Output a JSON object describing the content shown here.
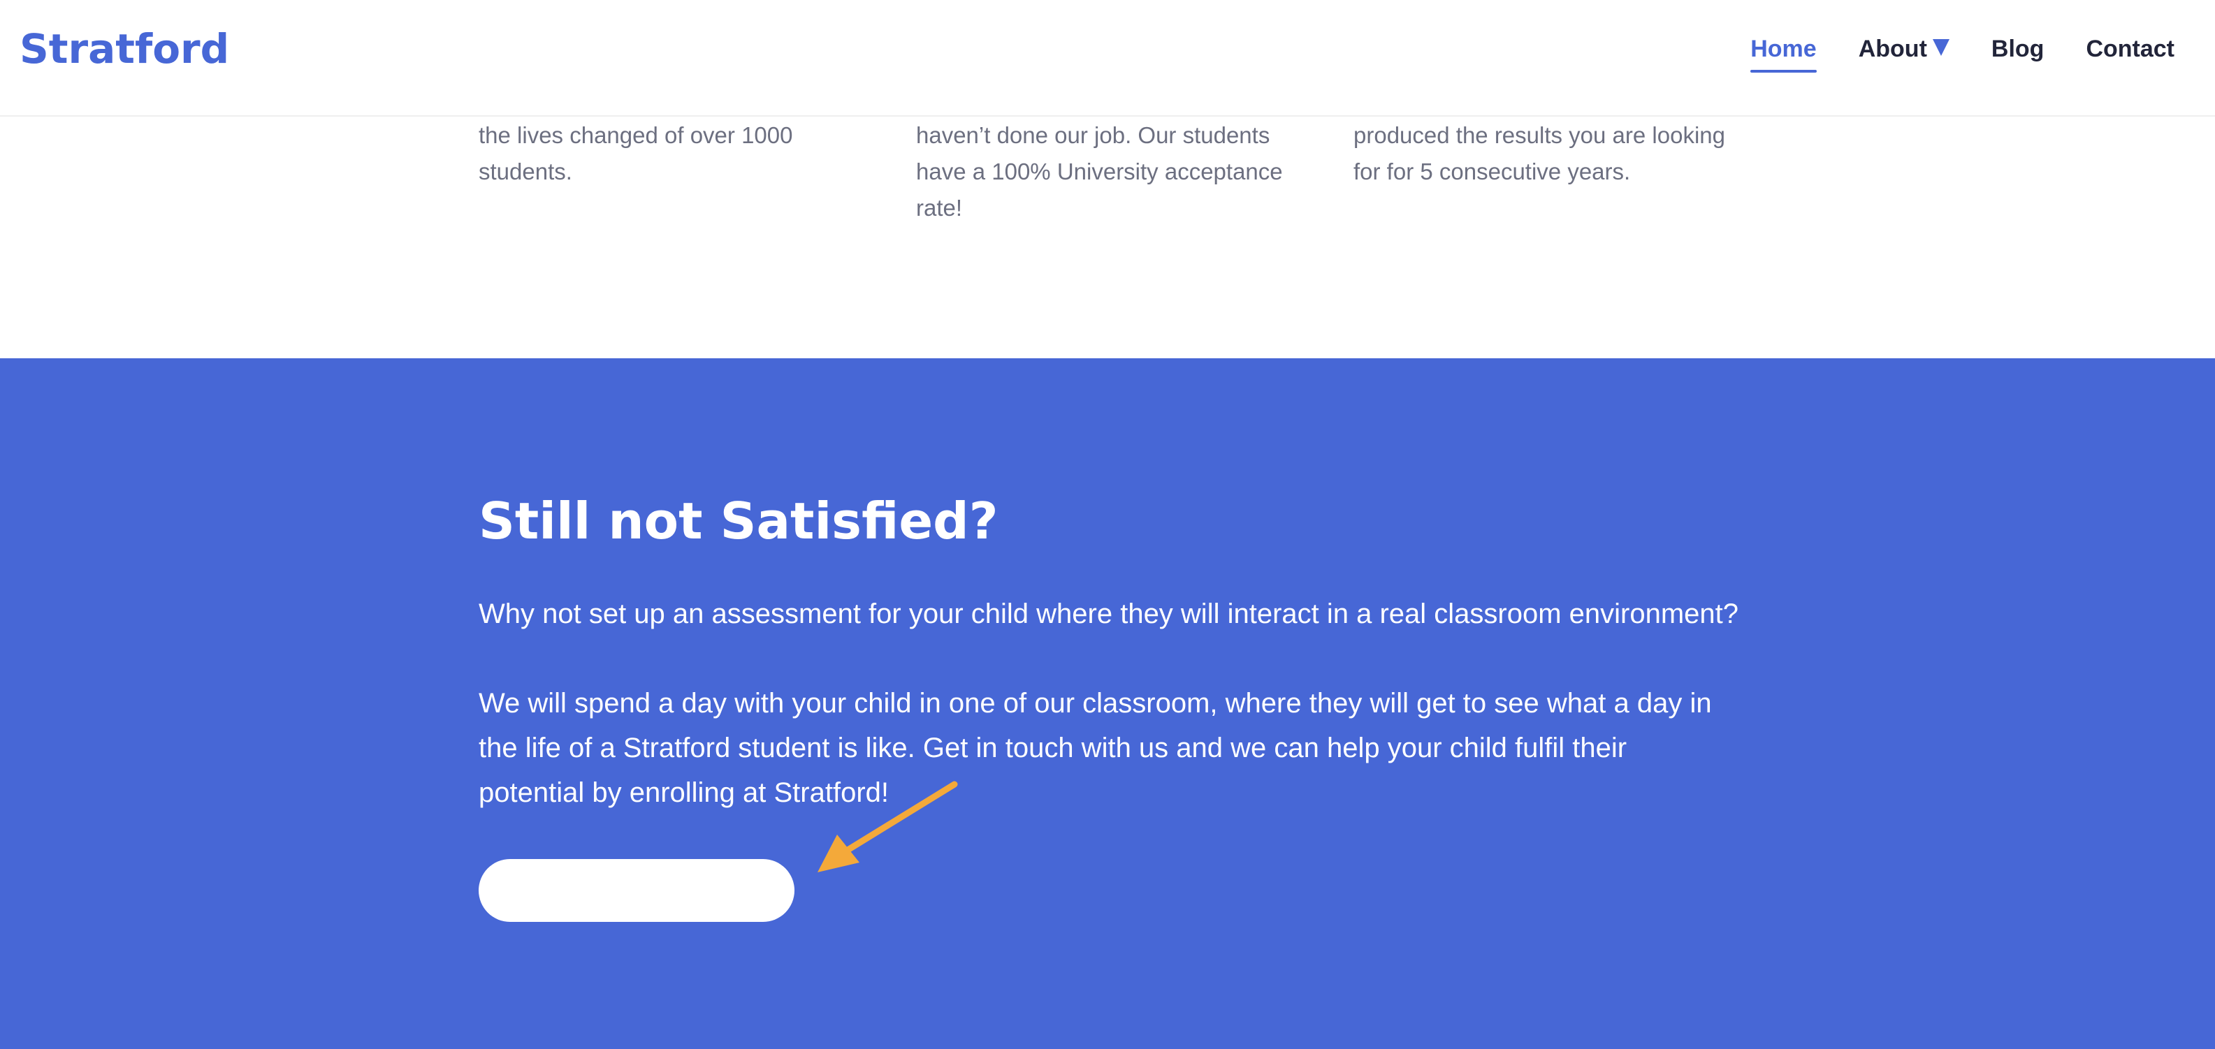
{
  "header": {
    "logo_text": "Stratford",
    "nav": [
      {
        "label": "Home",
        "active": true,
        "has_dropdown": false
      },
      {
        "label": "About",
        "active": false,
        "has_dropdown": true
      },
      {
        "label": "Blog",
        "active": false,
        "has_dropdown": false
      },
      {
        "label": "Contact",
        "active": false,
        "has_dropdown": false
      }
    ]
  },
  "features": {
    "col1": "the lives changed of over 1000 students.",
    "col2": "haven’t done our job. Our students have a 100% University acceptance rate!",
    "col3": "produced the results you are looking for for 5 consecutive years."
  },
  "cta": {
    "title": "Still not Satisfied?",
    "paragraph1": "Why not set up an assessment for your child where they will interact in a real classroom environment?",
    "paragraph2": "We will spend a day with your child in one of our classroom, where they will get to see what a day in the life of a Stratford student is like. Get in touch with us and we can help your child fulfil their potential by enrolling at Stratford!",
    "button_label": ""
  },
  "annotation": {
    "arrow_icon": "arrow-pointing-down-left-icon",
    "arrow_color": "#f4a93a"
  },
  "colors": {
    "brand_blue": "#4767d6",
    "white": "#ffffff",
    "nav_text": "#22253a",
    "muted_text": "#6c6f80"
  }
}
